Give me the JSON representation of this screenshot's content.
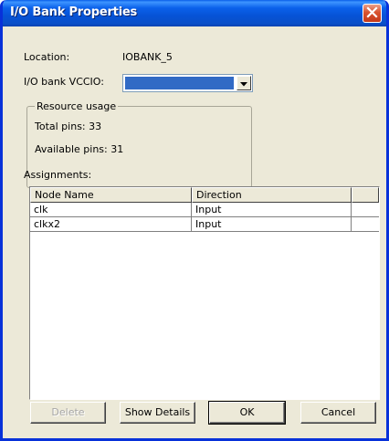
{
  "window": {
    "title": "I/O Bank Properties"
  },
  "icons": {
    "close": "close-icon",
    "dropdown": "chevron-down-icon"
  },
  "colors": {
    "titlebar": "#0a5fe8",
    "close_button": "#d9532f",
    "dialog_background": "#ece9d8",
    "selection": "#316ac5"
  },
  "location": {
    "label": "Location:",
    "value": "IOBANK_5"
  },
  "vccio": {
    "label": "I/O bank VCCIO:",
    "value": ""
  },
  "resource_usage": {
    "title": "Resource usage",
    "total_pins": "Total pins: 33",
    "available_pins": "Available pins: 31"
  },
  "assignments": {
    "label": "Assignments:",
    "columns": [
      "Node Name",
      "Direction"
    ],
    "rows": [
      {
        "node": "clk",
        "direction": "Input"
      },
      {
        "node": "clkx2",
        "direction": "Input"
      }
    ]
  },
  "buttons": {
    "delete": "Delete",
    "show_details": "Show Details",
    "ok": "OK",
    "cancel": "Cancel"
  }
}
